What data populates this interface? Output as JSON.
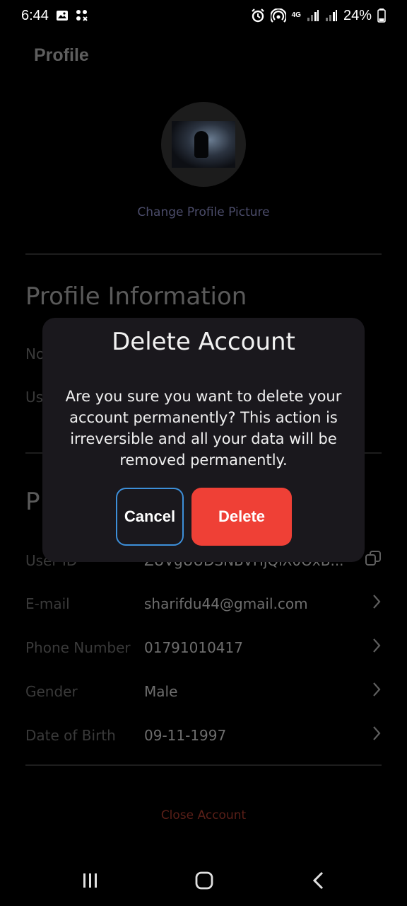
{
  "status_bar": {
    "time": "6:44",
    "network": "4G",
    "battery": "24%"
  },
  "header": {
    "title": "Profile"
  },
  "profile": {
    "change_picture": "Change Profile Picture"
  },
  "profile_information": {
    "title": "Profile Information",
    "rows": [
      {
        "label": "No",
        "value": ""
      },
      {
        "label": "Us",
        "value": ""
      }
    ]
  },
  "personal_information": {
    "title": "P",
    "rows": [
      {
        "label": "User ID",
        "value": "ZUVgUUDSNBVHjQiX0OxB..."
      },
      {
        "label": "E-mail",
        "value": "sharifdu44@gmail.com"
      },
      {
        "label": "Phone Number",
        "value": "01791010417"
      },
      {
        "label": "Gender",
        "value": "Male"
      },
      {
        "label": "Date of Birth",
        "value": "09-11-1997"
      }
    ]
  },
  "close_account": "Close Account",
  "dialog": {
    "title": "Delete Account",
    "message": "Are you sure you want to delete your account permanently? This action is irreversible and all your data will be removed permanently.",
    "cancel_label": "Cancel",
    "delete_label": "Delete"
  },
  "colors": {
    "delete_button": "#ef4036",
    "cancel_border": "#3d8fd9",
    "dialog_background": "#1a181d"
  }
}
